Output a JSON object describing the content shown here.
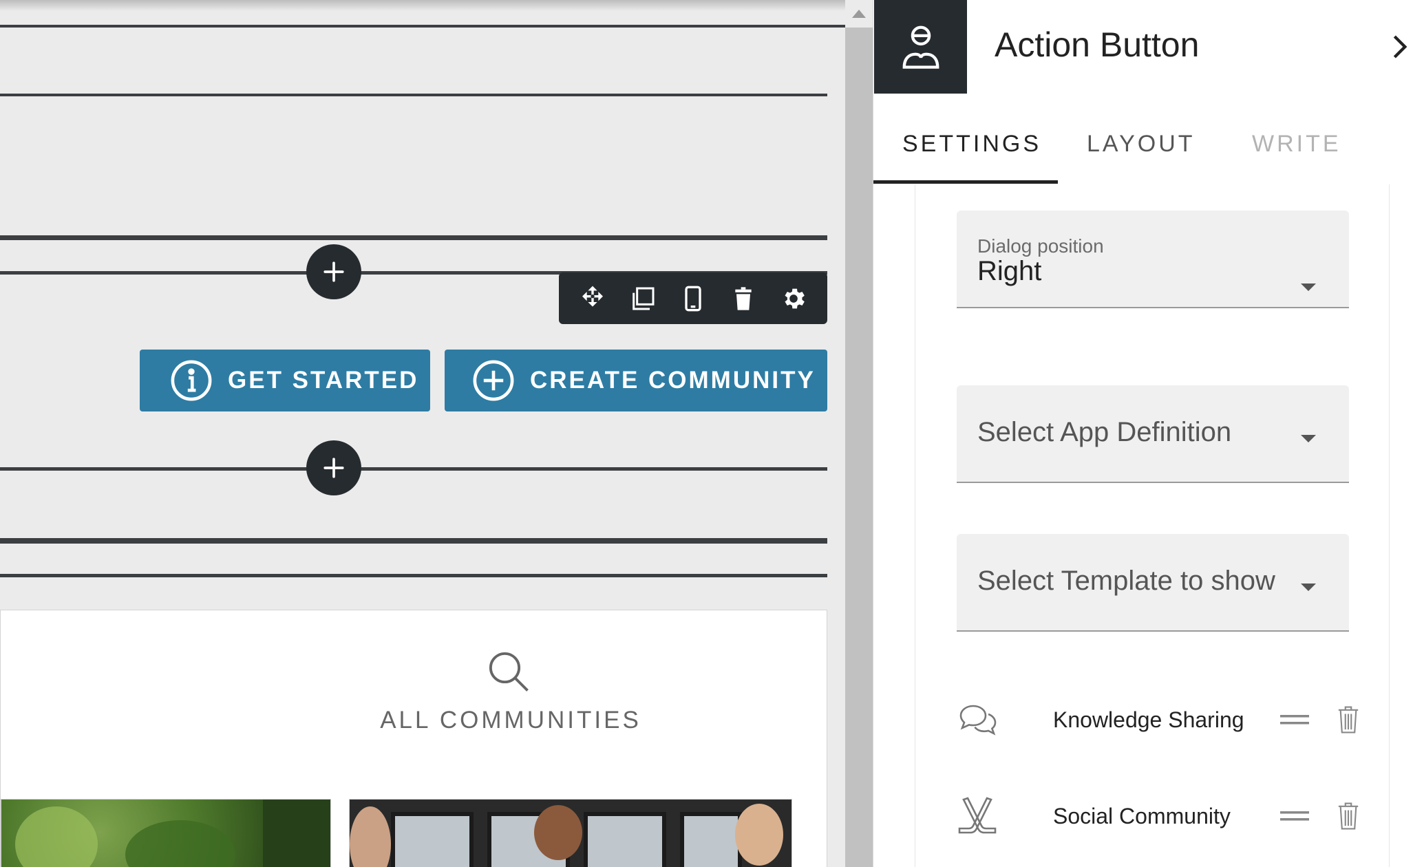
{
  "toolbar": {
    "icons": [
      "move-icon",
      "duplicate-icon",
      "mobile-icon",
      "trash-icon",
      "gear-icon"
    ]
  },
  "buttons": {
    "get_started": "GET STARTED",
    "create_community": "CREATE COMMUNITY"
  },
  "communities": {
    "title": "ALL COMMUNITIES"
  },
  "panel": {
    "title": "Action Button",
    "tabs": [
      {
        "label": "SETTINGS",
        "active": true
      },
      {
        "label": "LAYOUT",
        "active": false
      },
      {
        "label": "WRITE",
        "active": false,
        "disabled": true
      }
    ],
    "dialog_position": {
      "label": "Dialog position",
      "value": "Right"
    },
    "app_definition": {
      "placeholder": "Select App Definition"
    },
    "template": {
      "placeholder": "Select Template to show"
    },
    "apps": [
      {
        "name": "Knowledge Sharing",
        "icon": "chat-bubbles-icon"
      },
      {
        "name": "Social Community",
        "icon": "hockey-sticks-icon"
      }
    ]
  },
  "colors": {
    "accent": "#2e7ca3",
    "dark": "#262b2f"
  }
}
